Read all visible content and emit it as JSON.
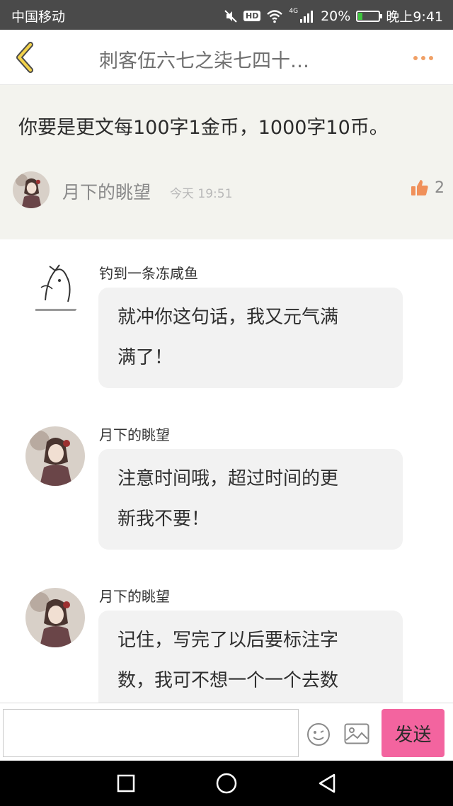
{
  "status_bar": {
    "carrier": "中国移动",
    "hd": "HD",
    "network": "4G",
    "battery_percent": "20%",
    "battery_level": 0.2,
    "time": "晚上9:41"
  },
  "header": {
    "title": "刺客伍六七之柒七四十…",
    "back_icon": "chevron-left-icon",
    "more_icon": "more-dots-icon"
  },
  "post": {
    "text": "你要是更文每100字1金币，1000字10币。",
    "author": "月下的眺望",
    "time": "今天 19:51",
    "likes": "2"
  },
  "replies": [
    {
      "author": "钓到一条冻咸鱼",
      "lines": [
        "就冲你这句话，我又元气满",
        "满了！"
      ]
    },
    {
      "author": "月下的眺望",
      "lines": [
        "注意时间哦，超过时间的更",
        "新我不要！"
      ]
    },
    {
      "author": "月下的眺望",
      "lines": [
        "记住，写完了以后要标注字",
        "数，我可不想一个一个去数"
      ]
    }
  ],
  "input": {
    "placeholder": "",
    "send_label": "发送"
  },
  "colors": {
    "accent": "#f0a066",
    "send": "#f3649f",
    "post_bg": "#f3f3ee",
    "bubble_bg": "#f2f2f2"
  }
}
